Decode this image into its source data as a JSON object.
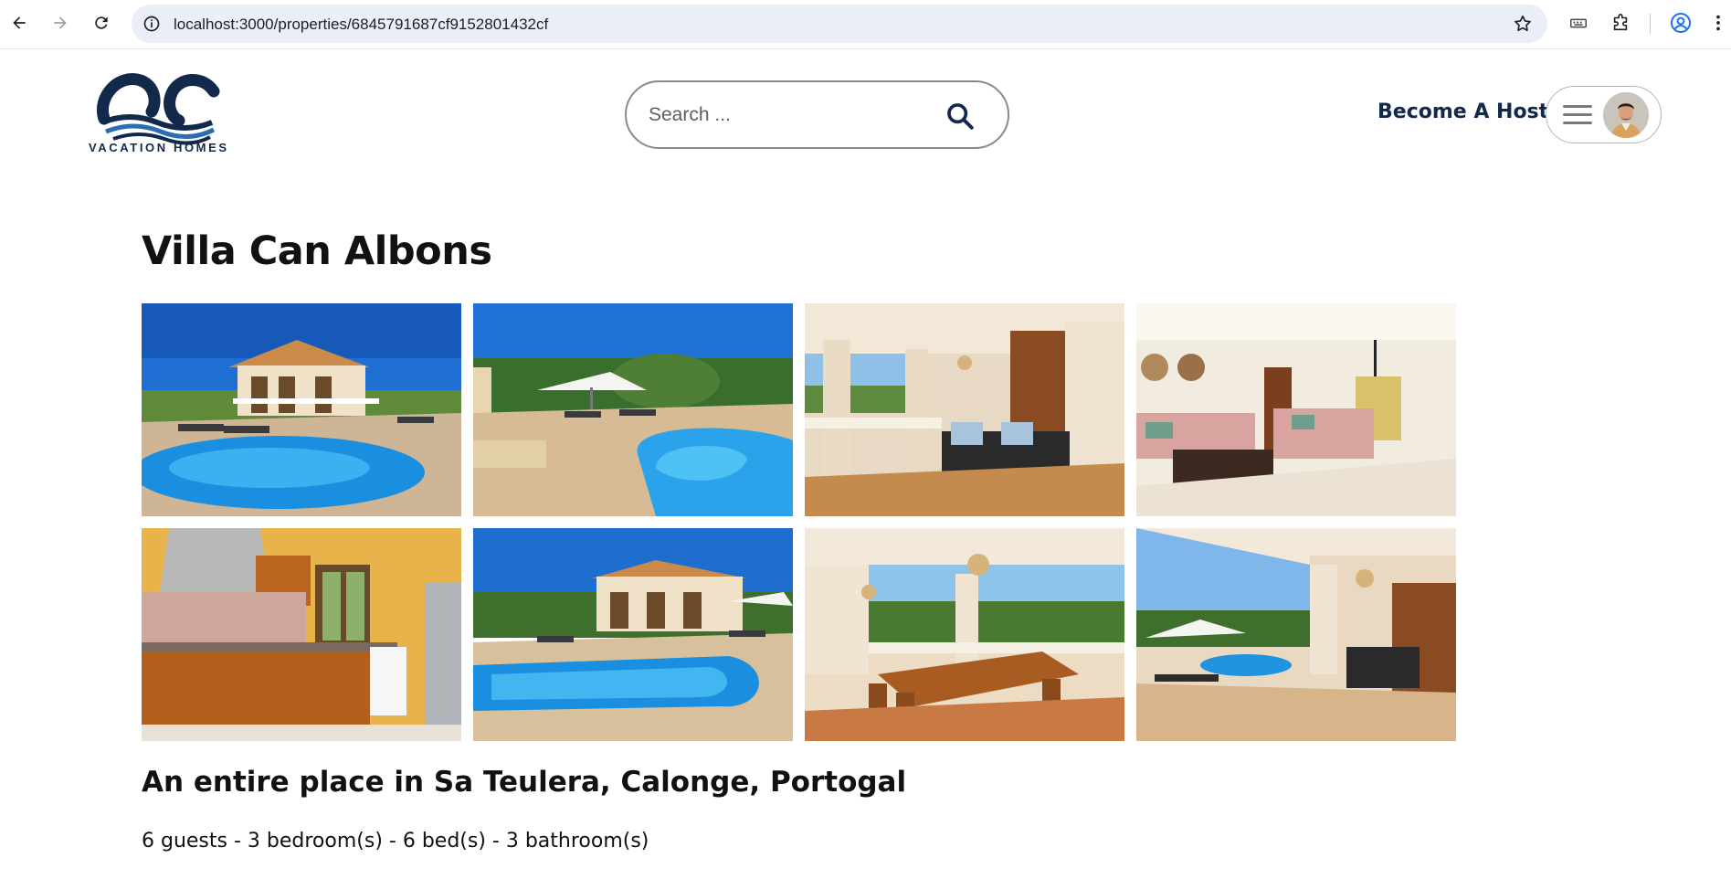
{
  "browser": {
    "url": "localhost:3000/properties/6845791687cf9152801432cf",
    "icons": [
      "back-icon",
      "forward-icon",
      "reload-icon",
      "site-info-icon",
      "bookmark-star-icon",
      "extension-dev-icon",
      "extensions-puzzle-icon",
      "profile-icon"
    ]
  },
  "header": {
    "logo_text": "VACATION HOMES",
    "search_placeholder": "Search ...",
    "become_host_label": "Become A Host",
    "brand_color": "#13294b"
  },
  "property": {
    "title": "Villa Can Albons",
    "subtitle": "An entire place in Sa Teulera, Calonge, Portogal",
    "details": "6 guests - 3 bedroom(s) - 6 bed(s) - 3 bathroom(s)",
    "photos": [
      {
        "subject": "villa exterior with pool"
      },
      {
        "subject": "pool terrace with umbrella"
      },
      {
        "subject": "covered porch with lounge seating"
      },
      {
        "subject": "living room with pink sofas"
      },
      {
        "subject": "kitchen"
      },
      {
        "subject": "villa and pool front view"
      },
      {
        "subject": "covered terrace dining table"
      },
      {
        "subject": "terrace overlooking pool"
      }
    ]
  }
}
